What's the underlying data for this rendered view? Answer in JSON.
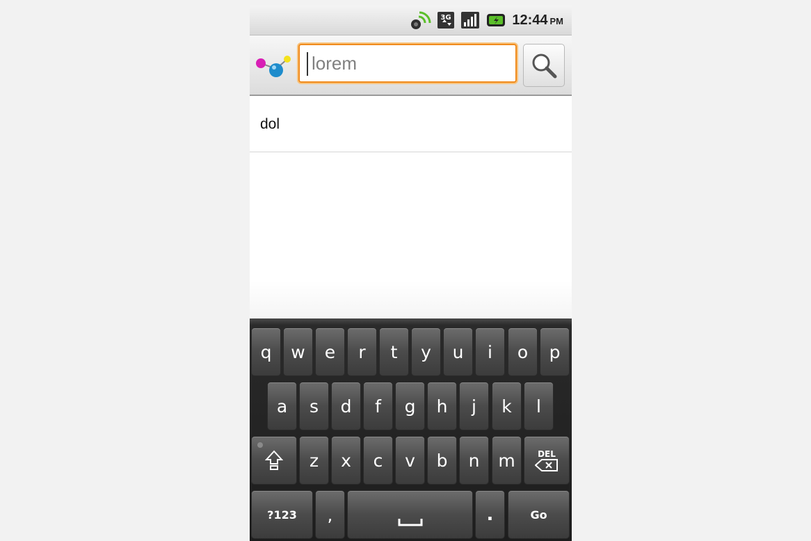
{
  "status_bar": {
    "icons": [
      "gps-icon",
      "3g-data-icon",
      "signal-icon",
      "battery-charging-icon"
    ],
    "network_label": "3G",
    "time": "12:44",
    "ampm": "PM"
  },
  "search": {
    "app_icon": "molecule-icon",
    "query": "lorem",
    "button_icon": "search-icon",
    "accent_color": "#f08a1c"
  },
  "suggestions": [
    {
      "label": "dol"
    }
  ],
  "keyboard": {
    "row1": [
      "q",
      "w",
      "e",
      "r",
      "t",
      "y",
      "u",
      "i",
      "o",
      "p"
    ],
    "row2": [
      "a",
      "s",
      "d",
      "f",
      "g",
      "h",
      "j",
      "k",
      "l"
    ],
    "row3": [
      "z",
      "x",
      "c",
      "v",
      "b",
      "n",
      "m"
    ],
    "shift_icon": "shift-icon",
    "delete_label": "DEL",
    "symbols_label": "?123",
    "comma_label": ",",
    "space_icon": "space-icon",
    "period_label": ".",
    "go_label": "Go"
  }
}
